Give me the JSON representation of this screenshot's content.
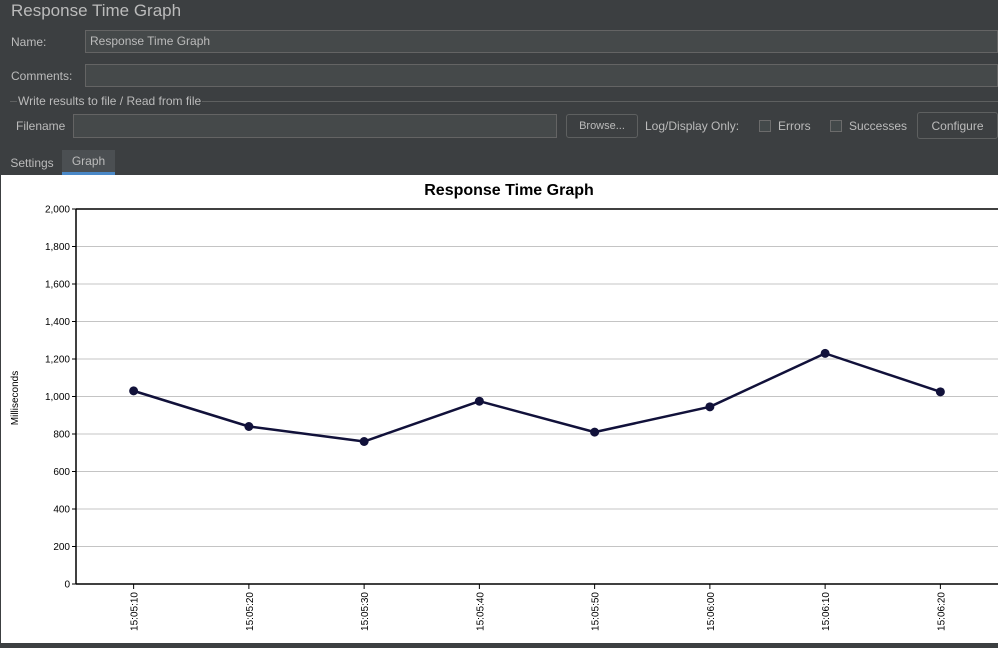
{
  "window": {
    "title": "Response Time Graph"
  },
  "form": {
    "name_label": "Name:",
    "name_value": "Response Time Graph",
    "comments_label": "Comments:",
    "comments_value": "",
    "file_group_title": "Write results to file / Read from file",
    "filename_label": "Filename",
    "filename_value": "",
    "browse_label": "Browse...",
    "log_display_label": "Log/Display Only:",
    "errors_label": "Errors",
    "errors_checked": false,
    "successes_label": "Successes",
    "successes_checked": false,
    "configure_label": "Configure"
  },
  "tabs": [
    {
      "label": "Settings",
      "active": false
    },
    {
      "label": "Graph",
      "active": true
    }
  ],
  "chart_data": {
    "type": "line",
    "title": "Response Time Graph",
    "xlabel": "",
    "ylabel": "Milliseconds",
    "x": [
      "15:05:10",
      "15:05:20",
      "15:05:30",
      "15:05:40",
      "15:05:50",
      "15:06:00",
      "15:06:10",
      "15:06:20"
    ],
    "series": [
      {
        "values": [
          1030,
          840,
          760,
          975,
          810,
          945,
          1230,
          1025
        ],
        "color": "#11113a"
      }
    ],
    "ylim": [
      0,
      2000
    ],
    "yticks": [
      0,
      200,
      400,
      600,
      800,
      1000,
      1200,
      1400,
      1600,
      1800,
      2000
    ],
    "ytick_labels": [
      "0",
      "200",
      "400",
      "600",
      "800",
      "1,000",
      "1,200",
      "1,400",
      "1,600",
      "1,800",
      "2,000"
    ],
    "grid": true,
    "legend": "none"
  }
}
